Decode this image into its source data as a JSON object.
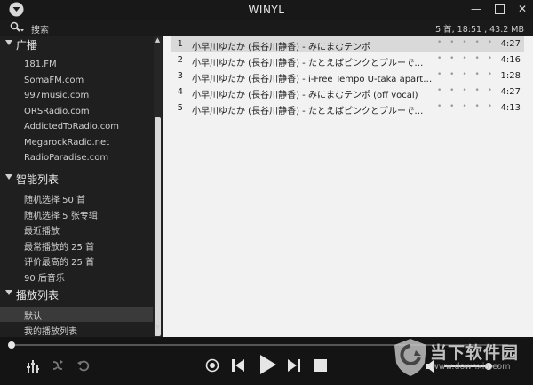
{
  "window": {
    "title": "WINYL",
    "logo_icon": "winyl-logo-icon",
    "menu_icon": "dropdown-menu-icon"
  },
  "toolbar": {
    "search_label": "搜索",
    "search_icon": "search-icon",
    "status": "5 首, 18:51 , 43.2 MB"
  },
  "sidebar": {
    "groups": [
      {
        "label": "广播",
        "items": [
          "181.FM",
          "SomaFM.com",
          "997music.com",
          "ORSRadio.com",
          "AddictedToRadio.com",
          "MegarockRadio.net",
          "RadioParadise.com"
        ]
      },
      {
        "label": "智能列表",
        "items": [
          "随机选择 50 首",
          "随机选择 5 张专辑",
          "最近播放",
          "最常播放的 25 首",
          "评价最高的 25 首",
          "90 后音乐"
        ]
      },
      {
        "label": "播放列表",
        "items": [
          "默认",
          "我的播放列表"
        ]
      }
    ],
    "selected": "默认"
  },
  "tracks": [
    {
      "num": "1",
      "title": "小早川ゆたか (長谷川静香) - みにまむテンポ",
      "rating": "• • • • •",
      "duration": "4:27",
      "active": true
    },
    {
      "num": "2",
      "title": "小早川ゆたか (長谷川静香) - たとえばピンクとブルーで…",
      "rating": "• • • • •",
      "duration": "4:16"
    },
    {
      "num": "3",
      "title": "小早川ゆたか (長谷川静香) - i-Free Tempo U-taka apart…",
      "rating": "• • • • •",
      "duration": "1:28"
    },
    {
      "num": "4",
      "title": "小早川ゆたか (長谷川静香) - みにまむテンポ (off vocal)",
      "rating": "• • • • •",
      "duration": "4:27"
    },
    {
      "num": "5",
      "title": "小早川ゆたか (長谷川静香) - たとえばピンクとブルーで…",
      "rating": "• • • • •",
      "duration": "4:13"
    }
  ],
  "player": {
    "progress": 0.0,
    "volume": 0.8,
    "icons": [
      "equalizer-icon",
      "shuffle-icon",
      "repeat-icon",
      "stop-icon",
      "previous-icon",
      "play-icon",
      "next-icon",
      "stop-square-icon",
      "volume-icon"
    ]
  },
  "watermark": {
    "text_cn": "当下软件园",
    "url": "www.downxia.com"
  },
  "colors": {
    "background": "#1a1a1a",
    "playlist_bg": "#f2f2f2",
    "active_row": "#d9d9d9"
  }
}
